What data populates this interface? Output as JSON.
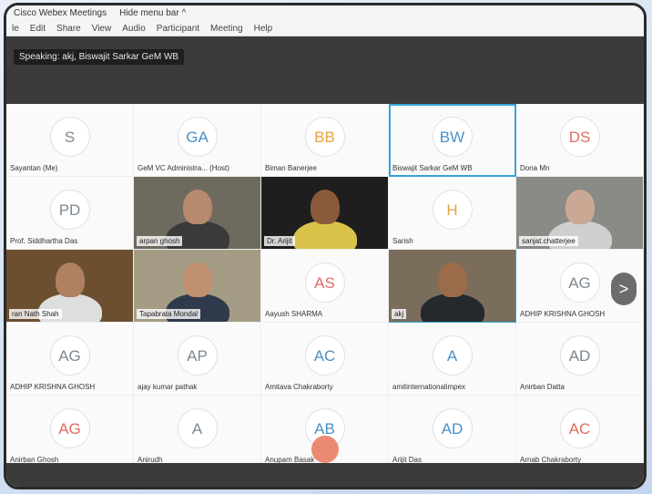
{
  "window": {
    "title": "Cisco Webex Meetings",
    "hide_menu": "Hide menu bar ^"
  },
  "menu": [
    "le",
    "Edit",
    "Share",
    "View",
    "Audio",
    "Participant",
    "Meeting",
    "Help"
  ],
  "speaking": "Speaking: akj, Biswajit Sarkar GeM WB",
  "participants": [
    {
      "initials": "S",
      "name": "Sayantan (Me)",
      "type": "avatar",
      "color": "#7e8891"
    },
    {
      "initials": "GA",
      "name": "GeM VC Administra... (Host)",
      "type": "avatar",
      "color": "#4a90c4"
    },
    {
      "initials": "BB",
      "name": "Biman Banerjee",
      "type": "avatar",
      "color": "#e6a23c"
    },
    {
      "initials": "BW",
      "name": "Biswajit Sarkar GeM WB",
      "type": "avatar",
      "color": "#4a90c4",
      "active": true
    },
    {
      "initials": "DS",
      "name": "Dona Mn",
      "type": "avatar",
      "color": "#e06b5e"
    },
    {
      "initials": "PD",
      "name": "Prof. Siddhartha Das",
      "type": "avatar",
      "color": "#7e8891"
    },
    {
      "name": "arpan ghosh",
      "type": "video"
    },
    {
      "name": "Dr. Arijit",
      "type": "video"
    },
    {
      "initials": "H",
      "name": "Sarish",
      "type": "avatar",
      "color": "#e6a23c"
    },
    {
      "name": "sanjat.chatterjee",
      "type": "video"
    },
    {
      "name": "ran Nath Shah",
      "type": "video"
    },
    {
      "name": "Tapabrata Mondal",
      "type": "video"
    },
    {
      "initials": "AS",
      "name": "Aayush SHARMA",
      "type": "avatar",
      "color": "#e06b5e"
    },
    {
      "name": "akj",
      "type": "video",
      "active": true
    },
    {
      "initials": "AG",
      "name": "ADHIP KRISHNA GHOSH",
      "type": "avatar",
      "color": "#7e8891"
    },
    {
      "initials": "AG",
      "name": "ADHIP KRISHNA GHOSH",
      "type": "avatar",
      "color": "#7e8891"
    },
    {
      "initials": "AP",
      "name": "ajay kumar pathak",
      "type": "avatar",
      "color": "#7e8891"
    },
    {
      "initials": "AC",
      "name": "Amitava Chakraborty",
      "type": "avatar",
      "color": "#4a90c4"
    },
    {
      "initials": "A",
      "name": "amitinternationalimpex",
      "type": "avatar",
      "color": "#4a90c4"
    },
    {
      "initials": "AD",
      "name": "Anirban Datta",
      "type": "avatar",
      "color": "#7e8891"
    },
    {
      "initials": "AG",
      "name": "Anirban Ghosh",
      "type": "avatar",
      "color": "#e06b5e"
    },
    {
      "initials": "A",
      "name": "Anirudh",
      "type": "avatar",
      "color": "#7e8891"
    },
    {
      "initials": "AB",
      "name": "Anupam Basak",
      "type": "avatar",
      "color": "#4a90c4"
    },
    {
      "initials": "AD",
      "name": "Arijit Das",
      "type": "avatar",
      "color": "#4a90c4"
    },
    {
      "initials": "AC",
      "name": "Arnab Chakraborty",
      "type": "avatar",
      "color": "#e06b5e"
    }
  ],
  "next_label": ">"
}
